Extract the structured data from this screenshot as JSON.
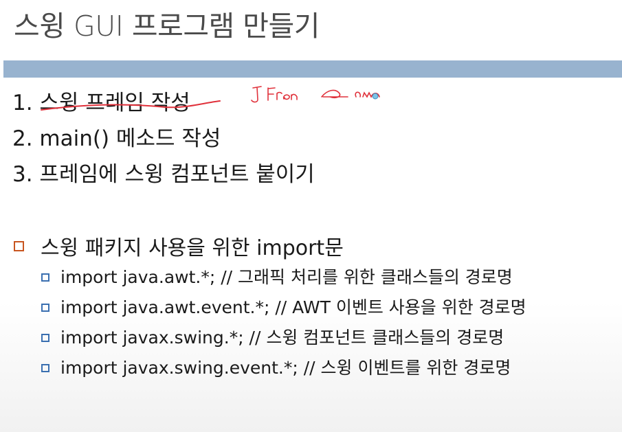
{
  "slide": {
    "title": "스윙 GUI 프로그램 만들기"
  },
  "steps": [
    {
      "text": "1. 스윙 프레임 작성"
    },
    {
      "text": "2. main() 메소드 작성"
    },
    {
      "text": "3. 프레임에 스윙 컴포넌트 붙이기"
    }
  ],
  "bullet": {
    "text": "스윙 패키지 사용을 위한 import문",
    "sub_items": [
      "import java.awt.*; // 그래픽 처리를 위한 클래스들의 경로명",
      "import java.awt.event.*; // AWT 이벤트 사용을 위한 경로명",
      "import javax.swing.*; // 스윙 컴포넌트 클래스들의 경로명",
      "import javax.swing.event.*; // 스윙 이벤트를 위한 경로명"
    ]
  },
  "colors": {
    "title_bar": "#98b3cf",
    "annotation_ink": "#e0303a",
    "main_bullet": "#c8551f",
    "sub_bullet": "#3a6fb0"
  }
}
